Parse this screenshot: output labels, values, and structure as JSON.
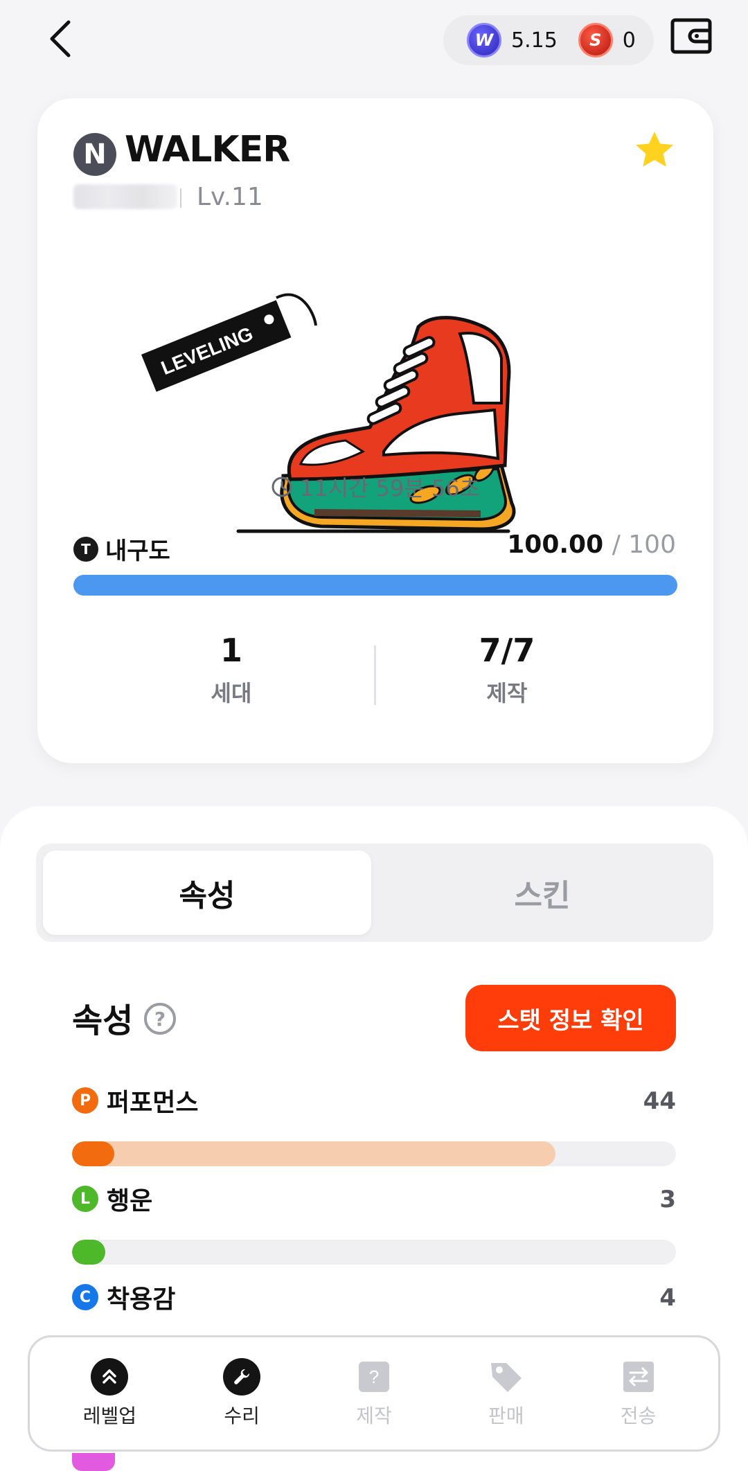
{
  "header": {
    "balances": [
      {
        "icon": "w-token-icon",
        "symbol": "W",
        "value": "5.15",
        "color": "#3a32d6"
      },
      {
        "icon": "s-token-icon",
        "symbol": "S",
        "value": "0",
        "color": "#e0281a"
      }
    ]
  },
  "card": {
    "rarity_badge": "N",
    "shoe_type": "WALKER",
    "level": "Lv.11",
    "tag_text": "LEVELING",
    "timer": "11시간 59분 56초",
    "durability": {
      "label": "내구도",
      "icon_letter": "T",
      "current": "100.00",
      "max": "/ 100",
      "percent": 100,
      "color": "#4c98f0"
    },
    "stats": [
      {
        "value": "1",
        "label": "세대"
      },
      {
        "value": "7/7",
        "label": "제작"
      }
    ]
  },
  "tabs": [
    {
      "label": "속성",
      "active": true
    },
    {
      "label": "스킨",
      "active": false
    }
  ],
  "attributes_section": {
    "title": "속성",
    "help": "?",
    "stat_button": "스탯 정보 확인",
    "items": [
      {
        "badge": "P",
        "name": "퍼포먼스",
        "value": "44",
        "color": "#f26b0f",
        "bonus_color": "#f7cdb0",
        "fill_fraction": 0.07,
        "bonus_fraction": 0.8
      },
      {
        "badge": "L",
        "name": "행운",
        "value": "3",
        "color": "#4cb82a",
        "bonus_color": "#dff1d6",
        "fill_fraction": 0.055,
        "bonus_fraction": 0
      },
      {
        "badge": "C",
        "name": "착용감",
        "value": "4",
        "color": "#1677e8",
        "bonus_color": "#d6e6fb",
        "fill_fraction": 0.06,
        "bonus_fraction": 0
      }
    ]
  },
  "nav": [
    {
      "label": "레벨업",
      "icon": "level-up-icon",
      "enabled": true
    },
    {
      "label": "수리",
      "icon": "wrench-icon",
      "enabled": true
    },
    {
      "label": "제작",
      "icon": "mint-box-icon",
      "enabled": false
    },
    {
      "label": "판매",
      "icon": "price-tag-icon",
      "enabled": false
    },
    {
      "label": "전송",
      "icon": "transfer-icon",
      "enabled": false
    }
  ]
}
